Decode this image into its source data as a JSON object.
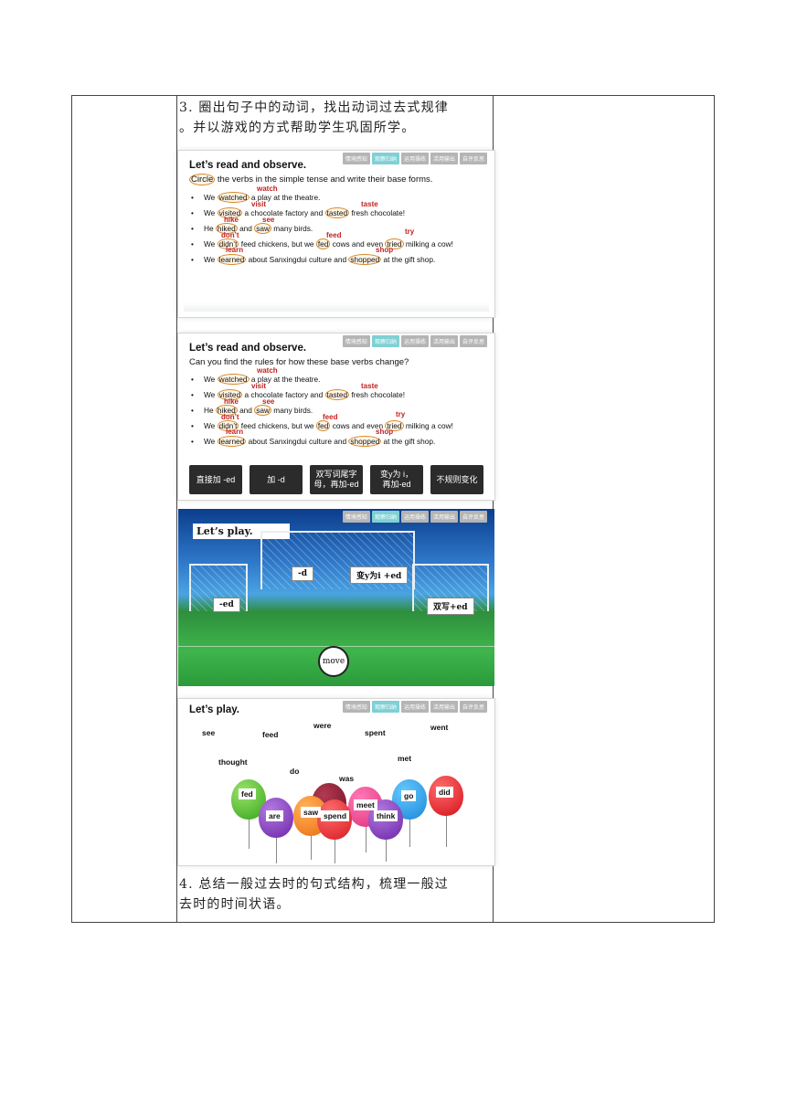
{
  "step3": "3. 圈出句子中的动词，找出动词过去式规律。并以游戏的方式帮助学生巩固所学。",
  "step3_line1": "3. 圈出句子中的动词，找出动词过去式规律",
  "step3_line2": "。并以游戏的方式帮助学生巩固所学。",
  "step4_line1": "4. 总结一般过去时的句式结构，梳理一般过",
  "step4_line2": "去时的时间状语。",
  "tabs": [
    "情境感知",
    "观察归纳",
    "运用操练",
    "活用输出",
    "自评反思"
  ],
  "slide1": {
    "title": "Let’s read and observe.",
    "circle": "Circle",
    "instruction": "the verbs in the simple tense and write their base forms.",
    "sentences": [
      {
        "pre": "We ",
        "v1": "watched",
        "post": " a play at the theatre."
      },
      {
        "pre": "We ",
        "v1": "visited",
        "mid": " a chocolate factory and ",
        "v2": "tasted",
        "post": " fresh chocolate!"
      },
      {
        "pre": "He ",
        "v1": "hiked",
        "mid": " and ",
        "v2": "saw",
        "post": " many birds."
      },
      {
        "pre": "We ",
        "v1": "didn’t",
        "mid": " feed chickens, but we ",
        "v2": "fed",
        "mid2": " cows and even ",
        "v3": "tried",
        "post": " milking a cow!"
      },
      {
        "pre": "We ",
        "v1": "learned",
        "mid": " about Sanxingdui culture and ",
        "v2": "shopped",
        "post": " at the gift shop."
      }
    ],
    "base_forms": [
      "watch",
      "visit",
      "taste",
      "hike",
      "see",
      "don’t",
      "feed",
      "try",
      "learn",
      "shop"
    ]
  },
  "slide2": {
    "title": "Let’s read and observe.",
    "instruction": "Can you find the rules for how these base verbs change?",
    "buttons": [
      "直接加 -ed",
      "加 -d",
      "双写词尾字母，再加-ed",
      "变y为 i，再加-ed",
      "不规则变化"
    ],
    "btn3a": "双写词尾字",
    "btn3b": "母，再加-ed",
    "btn4a": "变y为 i，",
    "btn4b": "再加-ed",
    "faded": [
      "watch",
      "learn",
      "taste",
      "hike",
      "saw",
      "feed"
    ]
  },
  "slide3": {
    "title": "Let’s play.",
    "labels": [
      "-d",
      "变y为i +ed",
      "-ed",
      "双写+ed"
    ],
    "ball": "move"
  },
  "slide4": {
    "title": "Let’s play.",
    "stars": [
      "see",
      "feed",
      "were",
      "spent",
      "went",
      "thought",
      "do",
      "met",
      "was"
    ],
    "balloons": [
      "fed",
      "are",
      "saw",
      "meet",
      "spend",
      "think",
      "go",
      "did"
    ]
  }
}
